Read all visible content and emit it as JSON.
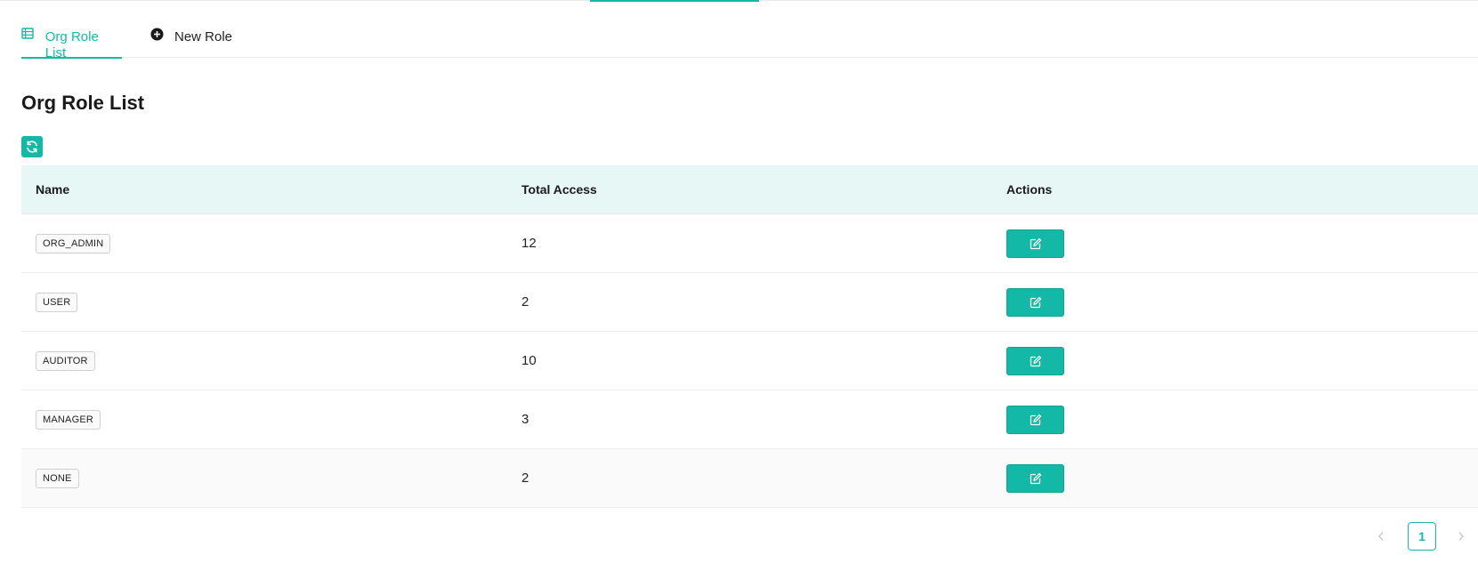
{
  "tabs": [
    {
      "label": "Org Role List",
      "icon": "table-list-icon",
      "active": true
    },
    {
      "label": "New Role",
      "icon": "plus-circle-icon",
      "active": false
    }
  ],
  "page_title": "Org Role List",
  "table": {
    "headers": {
      "name": "Name",
      "total_access": "Total Access",
      "actions": "Actions"
    },
    "rows": [
      {
        "name": "ORG_ADMIN",
        "total_access": "12"
      },
      {
        "name": "USER",
        "total_access": "2"
      },
      {
        "name": "AUDITOR",
        "total_access": "10"
      },
      {
        "name": "MANAGER",
        "total_access": "3"
      },
      {
        "name": "NONE",
        "total_access": "2"
      }
    ]
  },
  "pagination": {
    "current_page": "1"
  },
  "colors": {
    "accent": "#14b8a6",
    "header_bg": "#e6f7f5"
  }
}
